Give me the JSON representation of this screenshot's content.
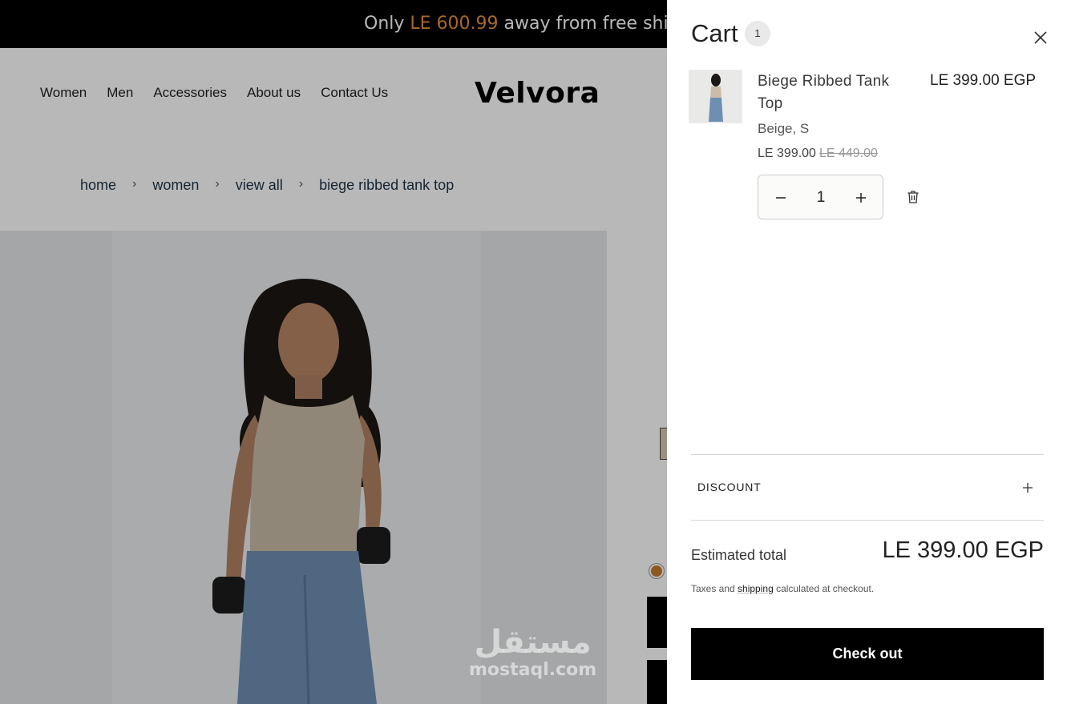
{
  "announcement": {
    "prefix": "Only",
    "amount": "LE 600.99",
    "suffix": "away from free shipping"
  },
  "nav": {
    "items": [
      "Women",
      "Men",
      "Accessories",
      "About us",
      "Contact Us"
    ]
  },
  "brand": {
    "logo": "Velvora"
  },
  "breadcrumb": {
    "items": [
      "home",
      "women",
      "view all",
      "biege ribbed tank top"
    ],
    "separator": "›"
  },
  "watermark": {
    "arabic": "مستقل",
    "latin": "mostaql.com"
  },
  "cart": {
    "title": "Cart",
    "count": "1",
    "item": {
      "name": "Biege Ribbed Tank Top",
      "price": "LE 399.00 EGP",
      "variant": "Beige, S",
      "sale_price": "LE 399.00",
      "compare_price": "LE 449.00",
      "quantity": "1"
    },
    "discount_label": "DISCOUNT",
    "estimated_label": "Estimated total",
    "estimated_value": "LE 399.00 EGP",
    "tax_prefix": "Taxes and",
    "tax_link": "shipping",
    "tax_suffix": "calculated at checkout.",
    "checkout_label": "Check out"
  },
  "colors": {
    "accent": "#e8913a",
    "button": "#000000",
    "overlay": "rgba(0,0,0,0.28)"
  },
  "icons": [
    "close-icon",
    "minus-icon",
    "plus-icon",
    "trash-icon"
  ]
}
